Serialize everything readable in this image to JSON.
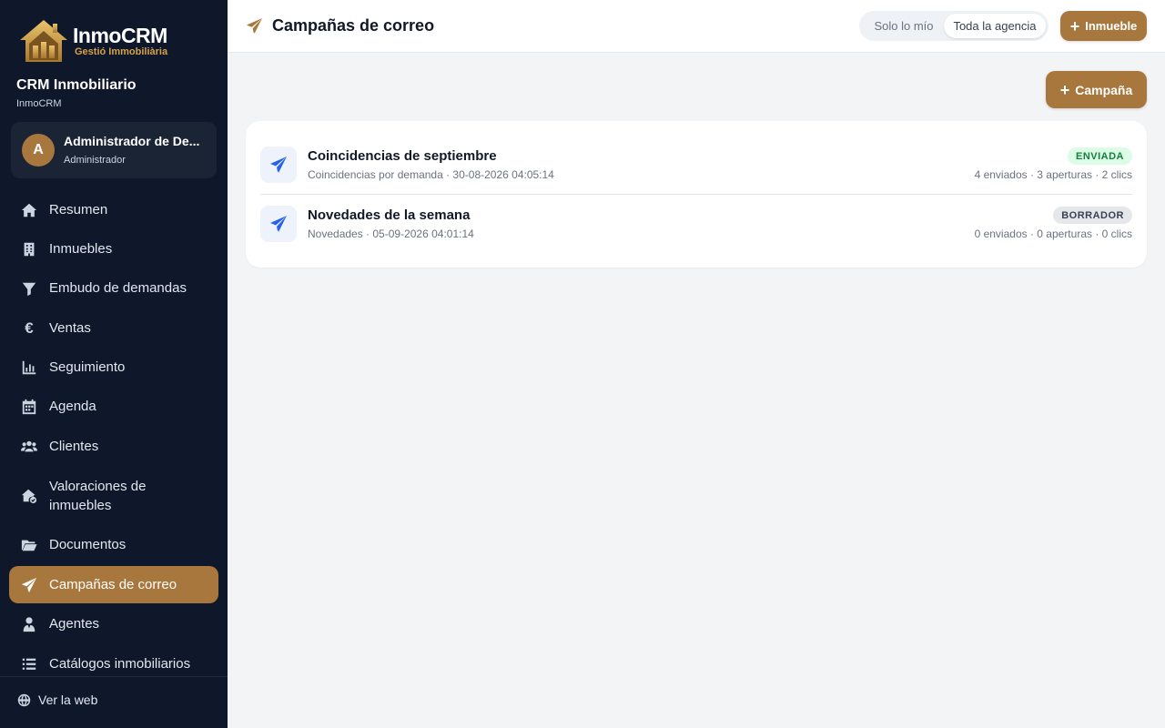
{
  "brand": {
    "logo_title": "InmoCRM",
    "logo_subtitle": "Gestió Immobiliària",
    "app_name": "CRM Inmobiliario",
    "app_subtitle": "InmoCRM"
  },
  "user": {
    "initial": "A",
    "name": "Administrador de De...",
    "role": "Administrador"
  },
  "sidebar": {
    "items": [
      {
        "label": "Resumen",
        "icon": "home-icon"
      },
      {
        "label": "Inmuebles",
        "icon": "building-icon"
      },
      {
        "label": "Embudo de demandas",
        "icon": "funnel-icon"
      },
      {
        "label": "Ventas",
        "icon": "euro-icon"
      },
      {
        "label": "Seguimiento",
        "icon": "chart-bar-icon"
      },
      {
        "label": "Agenda",
        "icon": "calendar-icon"
      },
      {
        "label": "Clientes",
        "icon": "users-icon"
      },
      {
        "label": "Valoraciones de inmuebles",
        "icon": "house-check-icon"
      },
      {
        "label": "Documentos",
        "icon": "folder-icon"
      },
      {
        "label": "Campañas de correo",
        "icon": "paper-plane-icon",
        "active": true
      },
      {
        "label": "Agentes",
        "icon": "user-tie-icon"
      },
      {
        "label": "Catálogos inmobiliarios",
        "icon": "list-icon"
      }
    ],
    "footer_link": "Ver la web"
  },
  "header": {
    "title": "Campañas de correo",
    "scope_options": [
      "Solo lo mío",
      "Toda la agencia"
    ],
    "scope_selected": "Toda la agencia",
    "add_property_label": "Inmueble"
  },
  "main": {
    "add_campaign_label": "Campaña",
    "campaigns": [
      {
        "title": "Coincidencias de septiembre",
        "meta": "Coincidencias por demanda · 30-08-2026 04:05:14",
        "status": "ENVIADA",
        "status_color": "#15803d",
        "stats": "4 enviados · 3 aperturas · 2 clics"
      },
      {
        "title": "Novedades de la semana",
        "meta": "Novedades · 05-09-2026 04:01:14",
        "status": "BORRADOR",
        "status_color": "#374151",
        "stats": "0 enviados · 0 aperturas · 0 clics"
      }
    ]
  },
  "colors": {
    "sidebar_bg": "#0f172a",
    "accent": "#a8773d",
    "link_blue": "#2563eb"
  }
}
